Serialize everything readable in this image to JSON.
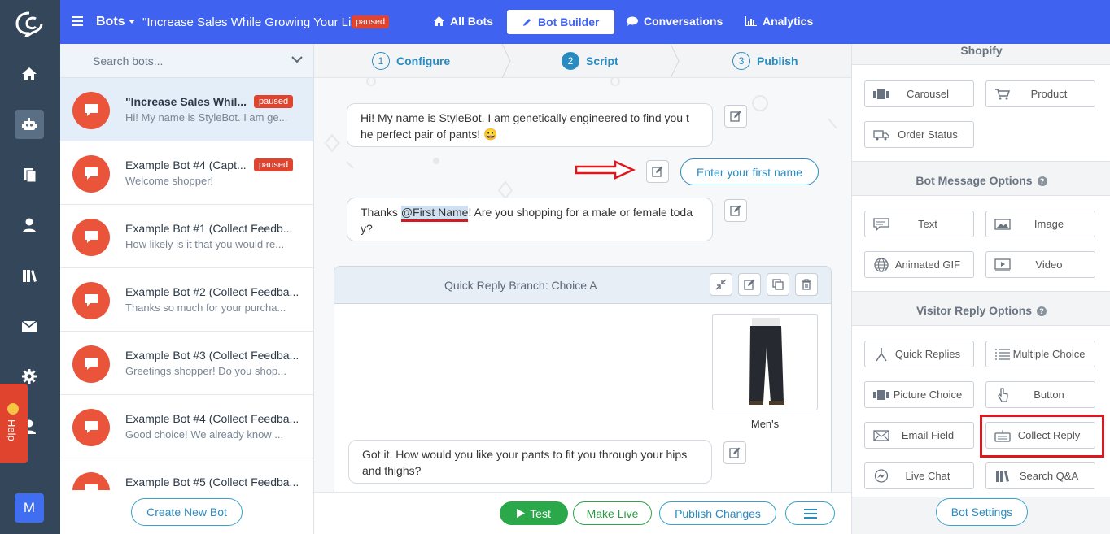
{
  "topbar": {
    "section": "Bots",
    "bot_title": "\"Increase Sales While Growing Your List\"",
    "status_badge": "paused",
    "nav": [
      {
        "label": "All Bots",
        "icon": "home-icon"
      },
      {
        "label": "Bot Builder",
        "icon": "pencil-icon"
      },
      {
        "label": "Conversations",
        "icon": "chat-icon"
      },
      {
        "label": "Analytics",
        "icon": "chart-icon"
      }
    ]
  },
  "rail": {
    "icons": [
      "logo-icon",
      "home-icon",
      "bot-icon",
      "document-icon",
      "user-icon",
      "library-icon",
      "mail-icon",
      "gear-icon",
      "user-icon"
    ],
    "help_label": "Help",
    "account_initial": "M"
  },
  "bot_list": {
    "search_placeholder": "Search bots...",
    "items": [
      {
        "name": "\"Increase Sales Whil...",
        "preview": "Hi! My name is StyleBot. I am ge...",
        "badge": "paused"
      },
      {
        "name": "Example Bot #4 (Capt...",
        "preview": "Welcome shopper!",
        "badge": "paused"
      },
      {
        "name": "Example Bot #1 (Collect Feedb...",
        "preview": "How likely is it that you would re...",
        "badge": ""
      },
      {
        "name": "Example Bot #2 (Collect Feedba...",
        "preview": "Thanks so much for your purcha...",
        "badge": ""
      },
      {
        "name": "Example Bot #3 (Collect Feedba...",
        "preview": "Greetings shopper! Do you shop...",
        "badge": ""
      },
      {
        "name": "Example Bot #4 (Collect Feedba...",
        "preview": "Good choice! We already know ...",
        "badge": ""
      },
      {
        "name": "Example Bot #5 (Collect Feedba...",
        "preview": "",
        "badge": ""
      }
    ],
    "create_label": "Create New Bot"
  },
  "steps": [
    {
      "num": "1",
      "label": "Configure"
    },
    {
      "num": "2",
      "label": "Script"
    },
    {
      "num": "3",
      "label": "Publish"
    }
  ],
  "script": {
    "msg1_line1": "Hi! My name is StyleBot. I am genetically engineered to find you t",
    "msg1_line2": "he perfect pair of pants! 😀",
    "reply_button": "Enter your first name",
    "msg2_prefix": "Thanks ",
    "msg2_tag": "@First Name",
    "msg2_suffix": "! Are you shopping for a male or female toda",
    "msg2_line2": "y?",
    "branch_title": "Quick Reply Branch: Choice A",
    "product_label": "Men's",
    "msg3_line1": "Got it. How would you like your pants to fit you through your hips",
    "msg3_line2": "and thighs?"
  },
  "bottom_actions": {
    "test": "Test",
    "make_live": "Make Live",
    "publish_changes": "Publish Changes"
  },
  "right_panel": {
    "shopify_title": "Shopify",
    "shopify": [
      {
        "label": "Carousel",
        "icon": "carousel-icon"
      },
      {
        "label": "Product",
        "icon": "cart-icon"
      },
      {
        "label": "Order Status",
        "icon": "truck-icon"
      }
    ],
    "bot_message_title": "Bot Message Options",
    "bot_message": [
      {
        "label": "Text",
        "icon": "text-bubble-icon"
      },
      {
        "label": "Image",
        "icon": "image-icon"
      },
      {
        "label": "Animated GIF",
        "icon": "globe-icon"
      },
      {
        "label": "Video",
        "icon": "video-icon"
      }
    ],
    "visitor_reply_title": "Visitor Reply Options",
    "visitor_reply": [
      {
        "label": "Quick Replies",
        "icon": "branch-icon"
      },
      {
        "label": "Multiple Choice",
        "icon": "list-icon"
      },
      {
        "label": "Picture Choice",
        "icon": "carousel-icon"
      },
      {
        "label": "Button",
        "icon": "pointer-icon"
      },
      {
        "label": "Email Field",
        "icon": "envelope-icon"
      },
      {
        "label": "Collect Reply",
        "icon": "keyboard-icon"
      },
      {
        "label": "Live Chat",
        "icon": "messenger-icon"
      },
      {
        "label": "Search Q&A",
        "icon": "books-icon"
      }
    ],
    "settings_label": "Bot Settings"
  },
  "colors": {
    "topbar": "#3f63f0",
    "rail": "#34465a",
    "avatar": "#e9543a",
    "paused": "#e0432e",
    "accent": "#2a8bc0",
    "test_button": "#2aa84a",
    "highlight": "#e0161c"
  }
}
